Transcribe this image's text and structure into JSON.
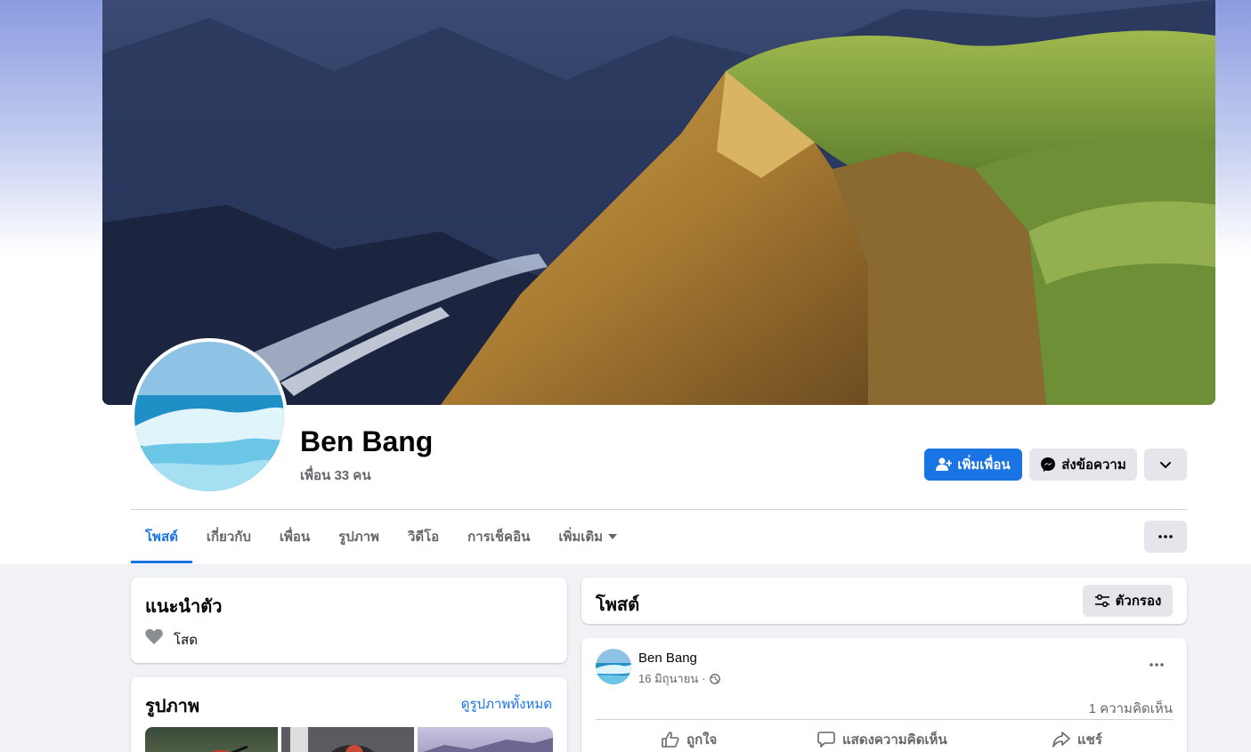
{
  "profile": {
    "name": "Ben Bang",
    "friends_text": "เพื่อน 33 คน"
  },
  "actions": {
    "add_friend": "เพิ่มเพื่อน",
    "message": "ส่งข้อความ"
  },
  "tabs": [
    {
      "label": "โพสต์",
      "active": true
    },
    {
      "label": "เกี่ยวกับ"
    },
    {
      "label": "เพื่อน"
    },
    {
      "label": "รูปภาพ"
    },
    {
      "label": "วิดีโอ"
    },
    {
      "label": "การเช็คอิน"
    },
    {
      "label": "เพิ่มเติม"
    }
  ],
  "intro": {
    "title": "แนะนำตัว",
    "relationship": "โสด"
  },
  "photos": {
    "title": "รูปภาพ",
    "see_all": "ดูรูปภาพทั้งหมด"
  },
  "posts_header": {
    "title": "โพสต์",
    "filter": "ตัวกรอง"
  },
  "post": {
    "author": "Ben Bang",
    "date": "16 มิถุนายน",
    "separator": "·",
    "comment_count": "1 ความคิดเห็น",
    "like": "ถูกใจ",
    "comment": "แสดงความคิดเห็น",
    "share": "แชร์"
  },
  "colors": {
    "accent": "#1b74e4",
    "page_bg": "#f0f2f5"
  },
  "icons": {
    "add_friend": "add-friend-icon",
    "messenger": "messenger-icon",
    "chevron": "chevron-down-icon",
    "more": "more-icon",
    "filter": "filter-icon",
    "heart": "heart-icon",
    "globe": "globe-icon",
    "like": "like-icon",
    "comment": "comment-icon",
    "share": "share-icon"
  }
}
